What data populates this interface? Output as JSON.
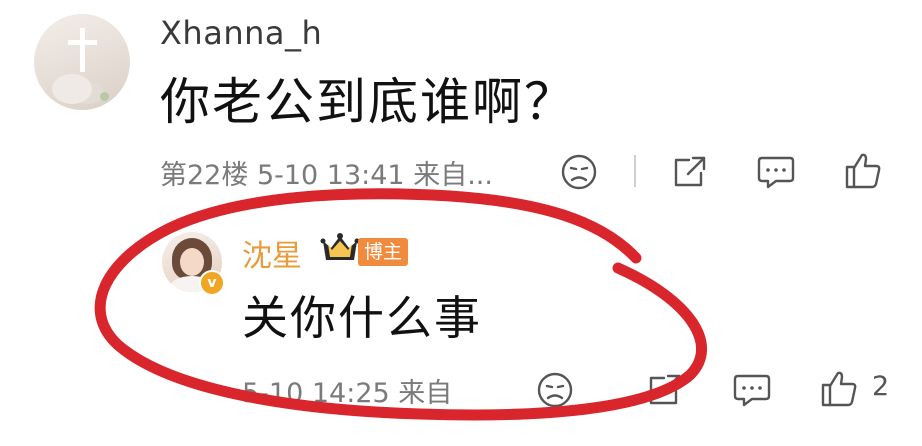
{
  "comment": {
    "username": "Xhanna_h",
    "text": "你老公到底谁啊？",
    "meta": "第22楼  5-10 13:41  来自..."
  },
  "reply": {
    "username": "沈星",
    "badge_label": "博主",
    "verified_mark": "v",
    "text": "关你什么事",
    "meta": "5-10 14:25  来自",
    "like_count": "2"
  },
  "icons": [
    "sad-emoji-icon",
    "share-icon",
    "comment-icon",
    "like-icon",
    "crown-icon"
  ],
  "colors": {
    "username_highlight": "#e79b3a",
    "badge": "#f08a3c",
    "annotation_circle": "#d9262c"
  }
}
